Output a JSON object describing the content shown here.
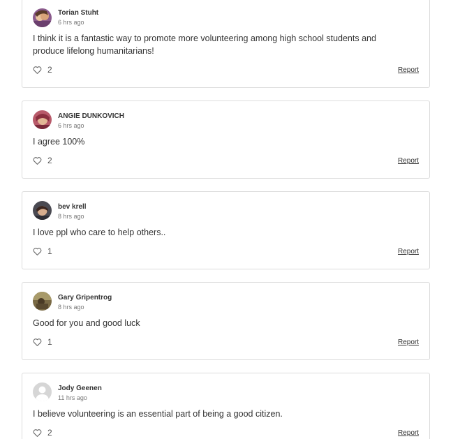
{
  "comments": [
    {
      "author": "Torian Stuht",
      "time": "6 hrs ago",
      "text": "I think it is a fantastic way to promote more volunteering among high school students and produce lifelong humanitarians!",
      "likes": "2",
      "report_label": "Report",
      "avatar_icon": "user-photo-avatar"
    },
    {
      "author": "ANGIE DUNKOVICH",
      "time": "6 hrs ago",
      "text": "I agree 100%",
      "likes": "2",
      "report_label": "Report",
      "avatar_icon": "user-photo-avatar"
    },
    {
      "author": "bev krell",
      "time": "8 hrs ago",
      "text": "I love ppl who care to help others..",
      "likes": "1",
      "report_label": "Report",
      "avatar_icon": "user-photo-avatar"
    },
    {
      "author": "Gary Gripentrog",
      "time": "8 hrs ago",
      "text": "Good for you and good luck",
      "likes": "1",
      "report_label": "Report",
      "avatar_icon": "user-photo-avatar"
    },
    {
      "author": "Jody Geenen",
      "time": "11 hrs ago",
      "text": "I believe volunteering is an essential part of being a good citizen.",
      "likes": "2",
      "report_label": "Report",
      "avatar_icon": "default-user-avatar"
    }
  ],
  "colors": {
    "card_border": "#dcdcdc",
    "text": "#333333",
    "muted": "#777777",
    "heart_outline": "#666666"
  }
}
